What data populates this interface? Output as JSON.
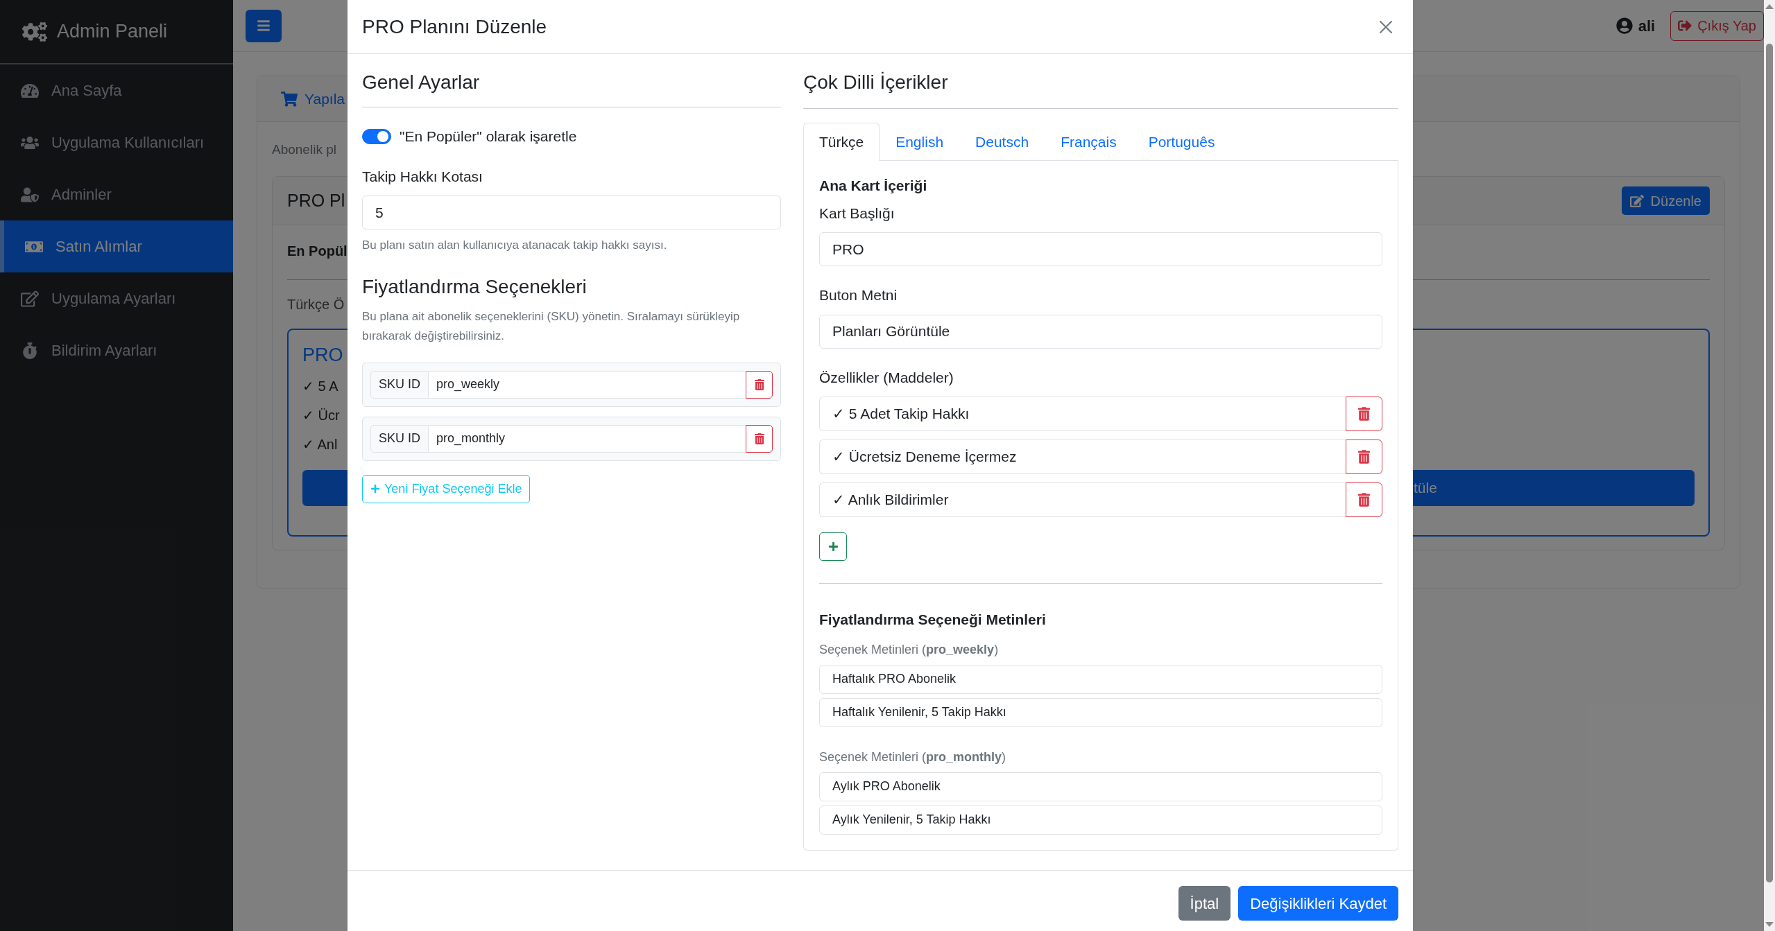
{
  "sidebar": {
    "brand": "Admin Paneli",
    "items": [
      {
        "label": "Ana Sayfa",
        "selected": false
      },
      {
        "label": "Uygulama Kullanıcıları",
        "selected": false
      },
      {
        "label": "Adminler",
        "selected": false
      },
      {
        "label": "Satın Alımlar",
        "selected": true
      },
      {
        "label": "Uygulama Ayarları",
        "selected": false
      },
      {
        "label": "Bildirim Ayarları",
        "selected": false
      }
    ]
  },
  "topbar": {
    "user": "ali",
    "logout_button": "Çıkış Yap"
  },
  "page": {
    "card_tab": "Yapıla",
    "intro": "Abonelik pl",
    "plan_card": {
      "title": "PRO Pl",
      "edit_button": "Düzenle",
      "popular_label": "En Popül",
      "preview_label": "Türkçe Ö",
      "preview": {
        "title": "PRO",
        "features": [
          "✓ 5 A",
          "✓ Ücr",
          "✓ Anl"
        ],
        "button": "tüle"
      }
    }
  },
  "modal": {
    "title": "PRO Planını Düzenle",
    "general": {
      "heading": "Genel Ayarlar",
      "popular_toggle": {
        "label": "\"En Popüler\" olarak işaretle",
        "on": true
      },
      "quota_label": "Takip Hakkı Kotası",
      "quota_value": "5",
      "quota_help": "Bu planı satın alan kullanıcıya atanacak takip hakkı sayısı."
    },
    "pricing": {
      "heading": "Fiyatlandırma Seçenekleri",
      "description": "Bu plana ait abonelik seçeneklerini (SKU) yönetin. Sıralamayı sürükleyip bırakarak değiştirebilirsiniz.",
      "skus": [
        {
          "prefix": "SKU ID",
          "value": "pro_weekly"
        },
        {
          "prefix": "SKU ID",
          "value": "pro_monthly"
        }
      ],
      "add_button": "Yeni Fiyat Seçeneği Ekle"
    },
    "content": {
      "heading": "Çok Dilli İçerikler",
      "tabs": [
        {
          "label": "Türkçe",
          "selected": true
        },
        {
          "label": "English",
          "selected": false
        },
        {
          "label": "Deutsch",
          "selected": false
        },
        {
          "label": "Français",
          "selected": false
        },
        {
          "label": "Português",
          "selected": false
        }
      ],
      "main_heading": "Ana Kart İçeriği",
      "card_title_label": "Kart Başlığı",
      "card_title_value": "PRO",
      "button_text_label": "Buton Metni",
      "button_text_value": "Planları Görüntüle",
      "features_label": "Özellikler (Maddeler)",
      "features": [
        "✓ 5 Adet Takip Hakkı",
        "✓ Ücretsiz Deneme İçermez",
        "✓ Anlık Bildirimler"
      ],
      "option_texts_heading": "Fiyatlandırma Seçeneği Metinleri",
      "option_texts": [
        {
          "label": "Seçenek Metinleri (**pro_weekly**)",
          "values": [
            "Haftalık PRO Abonelik",
            "Haftalık Yenilenir, 5 Takip Hakkı"
          ]
        },
        {
          "label": "Seçenek Metinleri (**pro_monthly**)",
          "values": [
            "Aylık PRO Abonelik",
            "Aylık Yenilenir, 5 Takip Hakkı"
          ]
        }
      ]
    },
    "footer": {
      "cancel": "İptal",
      "save": "Değişiklikleri Kaydet"
    }
  }
}
